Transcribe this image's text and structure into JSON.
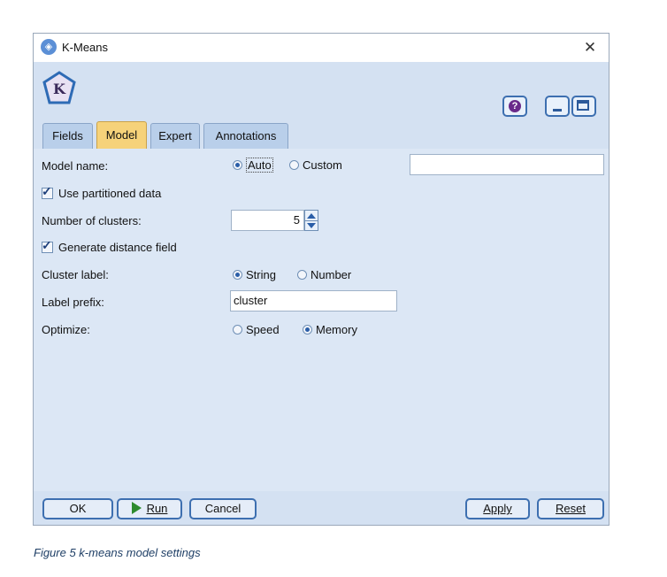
{
  "window": {
    "title": "K-Means",
    "close_glyph": "✕"
  },
  "header": {
    "logo_letter": "K",
    "help_glyph": "?"
  },
  "tabs": [
    {
      "label": "Fields"
    },
    {
      "label": "Model"
    },
    {
      "label": "Expert"
    },
    {
      "label": "Annotations"
    }
  ],
  "active_tab": "Model",
  "form": {
    "model_name_label": "Model name:",
    "model_name_options": [
      "Auto",
      "Custom"
    ],
    "model_name_selected": "Auto",
    "model_name_value": "",
    "use_partitioned_label": "Use partitioned data",
    "use_partitioned_checked": true,
    "clusters_label": "Number of clusters:",
    "clusters_value": "5",
    "generate_distance_label": "Generate distance field",
    "generate_distance_checked": true,
    "cluster_label_label": "Cluster label:",
    "cluster_label_options": [
      "String",
      "Number"
    ],
    "cluster_label_selected": "String",
    "label_prefix_label": "Label prefix:",
    "label_prefix_value": "cluster",
    "optimize_label": "Optimize:",
    "optimize_options": [
      "Speed",
      "Memory"
    ],
    "optimize_selected": "Memory"
  },
  "footer": {
    "ok": "OK",
    "run": "Run",
    "cancel": "Cancel",
    "apply": "Apply",
    "reset": "Reset"
  },
  "caption": "Figure 5 k-means model settings",
  "colors": {
    "active_tab": "#f6d27a",
    "panel": "#dce7f5",
    "button_border": "#3d6fb0",
    "run_icon": "#2e8b2e"
  }
}
